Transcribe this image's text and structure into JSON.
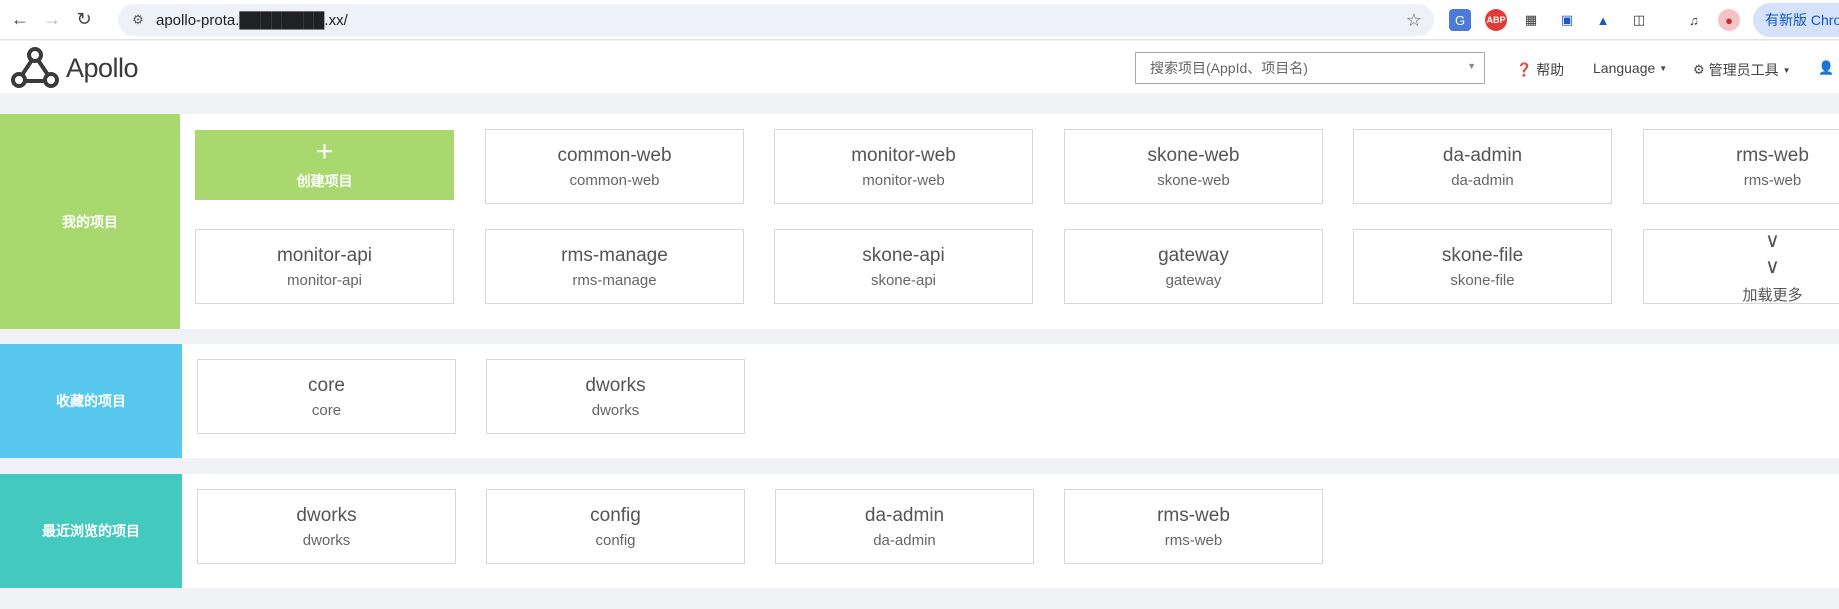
{
  "browser": {
    "url": "apollo-prota.████████.xx/",
    "update_label": "有新版 Chrome"
  },
  "header": {
    "logo_text": "Apollo",
    "search_placeholder": "搜索项目(AppId、项目名)",
    "help_label": "帮助",
    "language_label": "Language",
    "admin_tools_label": "管理员工具"
  },
  "sections": {
    "my_projects": {
      "label": "我的项目",
      "color": "#a9d86e",
      "create_label": "创建项目",
      "load_more_label": "加载更多",
      "projects": [
        {
          "name": "common-web",
          "appid": "common-web"
        },
        {
          "name": "monitor-web",
          "appid": "monitor-web"
        },
        {
          "name": "skone-web",
          "appid": "skone-web"
        },
        {
          "name": "da-admin",
          "appid": "da-admin"
        },
        {
          "name": "rms-web",
          "appid": "rms-web"
        },
        {
          "name": "monitor-api",
          "appid": "monitor-api"
        },
        {
          "name": "rms-manage",
          "appid": "rms-manage"
        },
        {
          "name": "skone-api",
          "appid": "skone-api"
        },
        {
          "name": "gateway",
          "appid": "gateway"
        },
        {
          "name": "skone-file",
          "appid": "skone-file"
        }
      ]
    },
    "favorites": {
      "label": "收藏的项目",
      "color": "#58c8ef",
      "projects": [
        {
          "name": "core",
          "appid": "core"
        },
        {
          "name": "dworks",
          "appid": "dworks"
        }
      ]
    },
    "recent": {
      "label": "最近浏览的项目",
      "color": "#43c9be",
      "projects": [
        {
          "name": "dworks",
          "appid": "dworks"
        },
        {
          "name": "config",
          "appid": "config"
        },
        {
          "name": "da-admin",
          "appid": "da-admin"
        },
        {
          "name": "rms-web",
          "appid": "rms-web"
        }
      ]
    }
  }
}
